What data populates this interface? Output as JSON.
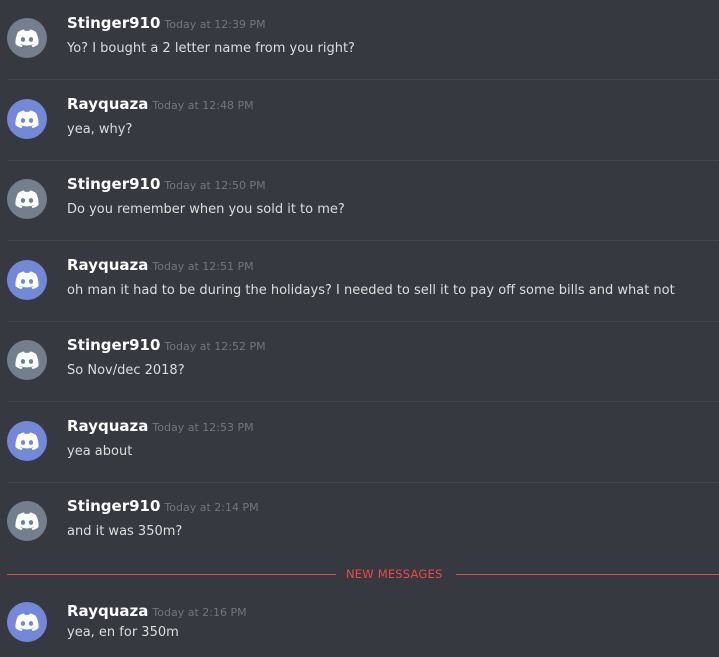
{
  "messages": [
    {
      "username": "Stinger910",
      "timestamp": "Today at 12:39 PM",
      "text": "Yo? I bought a  2 letter name from you right?"
    },
    {
      "username": "Rayquaza",
      "timestamp": "Today at 12:48 PM",
      "text": "yea, why?"
    },
    {
      "username": "Stinger910",
      "timestamp": "Today at 12:50 PM",
      "text": "Do you remember when you sold it to me?"
    },
    {
      "username": "Rayquaza",
      "timestamp": "Today at 12:51 PM",
      "text": "oh man it had to be during the holidays?  I needed to sell it to pay off some bills and what not"
    },
    {
      "username": "Stinger910",
      "timestamp": "Today at 12:52 PM",
      "text": "So Nov/dec 2018?"
    },
    {
      "username": "Rayquaza",
      "timestamp": "Today at 12:53 PM",
      "text": "yea about"
    },
    {
      "username": "Stinger910",
      "timestamp": "Today at 2:14 PM",
      "text": "and it was 350m?"
    },
    {
      "username": "Rayquaza",
      "timestamp": "Today at 2:16 PM",
      "text": "yea, en for 350m"
    }
  ],
  "new_messages_label": "NEW MESSAGES",
  "avatars": {
    "Stinger910": {
      "icon": "discord-default-avatar-icon",
      "color": "#747f8d"
    },
    "Rayquaza": {
      "icon": "discord-default-avatar-icon",
      "color": "#7289da"
    }
  },
  "colors": {
    "background": "#36393f",
    "divider": "#42454a",
    "new_messages": "#f04747",
    "username": "#ffffff",
    "timestamp": "#72767d",
    "message_text": "#dcddde"
  }
}
